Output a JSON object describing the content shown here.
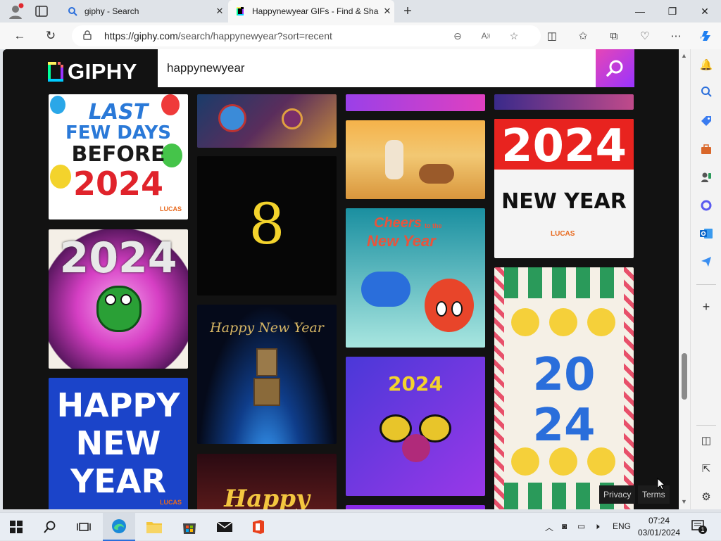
{
  "browser": {
    "tabs": [
      {
        "title": "giphy - Search",
        "active": false
      },
      {
        "title": "Happynewyear GIFs - Find & Sha",
        "active": true
      }
    ],
    "url": {
      "host": "https://giphy.com",
      "path": "/search/happynewyear?sort=recent"
    }
  },
  "giphy": {
    "logo_text": "GIPHY",
    "search_value": "happynewyear",
    "footer_links": [
      "Privacy",
      "Terms"
    ]
  },
  "gifs": {
    "card1": {
      "lines": [
        "LAST",
        "FEW DAYS",
        "BEFORE",
        "2024"
      ],
      "badge": "LUCAS"
    },
    "card2": {
      "text": "2024"
    },
    "card3": {
      "lines": [
        "HAPPY",
        "NEW",
        "YEAR"
      ],
      "badge": "LUCAS"
    },
    "card5": {
      "text": "8"
    },
    "card6": {
      "text": "Happy New Year"
    },
    "card7": {
      "text": "Happy"
    },
    "card10": {
      "line1": "Cheers",
      "line2": "to the",
      "line3": "New Year"
    },
    "card11": {
      "text": "2024"
    },
    "card13": {
      "top": "2024",
      "bottom": "NEW YEAR",
      "badge": "LUCAS"
    },
    "card14": {
      "top": "20",
      "bottom": "24"
    }
  },
  "taskbar": {
    "lang": "ENG",
    "time": "07:24",
    "date": "03/01/2024",
    "notif_count": "1"
  },
  "colors": {
    "giphy_bg": "#121212",
    "search_gradient_start": "#e646b6",
    "search_gradient_end": "#9933ff"
  }
}
